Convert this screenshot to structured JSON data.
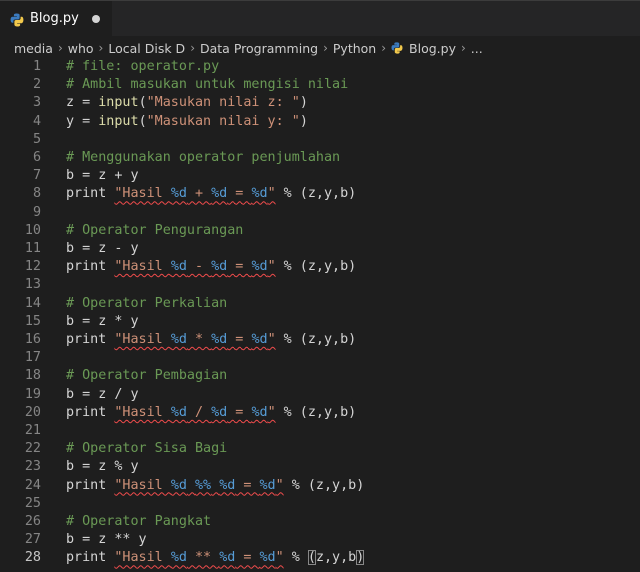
{
  "tab": {
    "label": "Blog.py",
    "icon": "python-file-icon",
    "dirty": true
  },
  "breadcrumb": [
    "media",
    "who",
    "Local Disk D",
    "Data Programming",
    "Python",
    "Blog.py",
    "..."
  ],
  "colors": {
    "background": "#1e1e1e",
    "comment": "#6a9955",
    "string": "#ce9178",
    "format": "#569cd6",
    "function": "#dcdcaa",
    "error_squiggle": "#f14c4c"
  },
  "active_line": 28,
  "lines": [
    {
      "num": "1",
      "tokens": [
        {
          "t": "# file: operator.py",
          "c": "comment"
        }
      ]
    },
    {
      "num": "2",
      "tokens": [
        {
          "t": "# Ambil masukan untuk mengisi nilai",
          "c": "comment"
        }
      ]
    },
    {
      "num": "3",
      "tokens": [
        {
          "t": "z = ",
          "c": "plain"
        },
        {
          "t": "input",
          "c": "func"
        },
        {
          "t": "(",
          "c": "plain"
        },
        {
          "t": "\"Masukan nilai z: \"",
          "c": "string"
        },
        {
          "t": ")",
          "c": "plain"
        }
      ]
    },
    {
      "num": "4",
      "tokens": [
        {
          "t": "y = ",
          "c": "plain"
        },
        {
          "t": "input",
          "c": "func"
        },
        {
          "t": "(",
          "c": "plain"
        },
        {
          "t": "\"Masukan nilai y: \"",
          "c": "string"
        },
        {
          "t": ")",
          "c": "plain"
        }
      ]
    },
    {
      "num": "5",
      "tokens": []
    },
    {
      "num": "6",
      "tokens": [
        {
          "t": "# Menggunakan operator penjumlahan",
          "c": "comment"
        }
      ]
    },
    {
      "num": "7",
      "tokens": [
        {
          "t": "b = z + y",
          "c": "plain"
        }
      ]
    },
    {
      "num": "8",
      "tokens": [
        {
          "t": "print ",
          "c": "plain"
        },
        {
          "t": "\"Hasil ",
          "c": "string",
          "err": true
        },
        {
          "t": "%d",
          "c": "fmt",
          "err": true
        },
        {
          "t": " + ",
          "c": "string",
          "err": true
        },
        {
          "t": "%d",
          "c": "fmt",
          "err": true
        },
        {
          "t": " = ",
          "c": "string",
          "err": true
        },
        {
          "t": "%d",
          "c": "fmt",
          "err": true
        },
        {
          "t": "\"",
          "c": "string",
          "err": true
        },
        {
          "t": " % (z,y,b)",
          "c": "plain"
        }
      ]
    },
    {
      "num": "9",
      "tokens": []
    },
    {
      "num": "10",
      "tokens": [
        {
          "t": "# Operator Pengurangan",
          "c": "comment"
        }
      ]
    },
    {
      "num": "11",
      "tokens": [
        {
          "t": "b = z - y",
          "c": "plain"
        }
      ]
    },
    {
      "num": "12",
      "tokens": [
        {
          "t": "print ",
          "c": "plain"
        },
        {
          "t": "\"Hasil ",
          "c": "string",
          "err": true
        },
        {
          "t": "%d",
          "c": "fmt",
          "err": true
        },
        {
          "t": " - ",
          "c": "string",
          "err": true
        },
        {
          "t": "%d",
          "c": "fmt",
          "err": true
        },
        {
          "t": " = ",
          "c": "string",
          "err": true
        },
        {
          "t": "%d",
          "c": "fmt",
          "err": true
        },
        {
          "t": "\"",
          "c": "string",
          "err": true
        },
        {
          "t": " % (z,y,b)",
          "c": "plain"
        }
      ]
    },
    {
      "num": "13",
      "tokens": []
    },
    {
      "num": "14",
      "tokens": [
        {
          "t": "# Operator Perkalian",
          "c": "comment"
        }
      ]
    },
    {
      "num": "15",
      "tokens": [
        {
          "t": "b = z * y",
          "c": "plain"
        }
      ]
    },
    {
      "num": "16",
      "tokens": [
        {
          "t": "print ",
          "c": "plain"
        },
        {
          "t": "\"Hasil ",
          "c": "string",
          "err": true
        },
        {
          "t": "%d",
          "c": "fmt",
          "err": true
        },
        {
          "t": " * ",
          "c": "string",
          "err": true
        },
        {
          "t": "%d",
          "c": "fmt",
          "err": true
        },
        {
          "t": " = ",
          "c": "string",
          "err": true
        },
        {
          "t": "%d",
          "c": "fmt",
          "err": true
        },
        {
          "t": "\"",
          "c": "string",
          "err": true
        },
        {
          "t": " % (z,y,b)",
          "c": "plain"
        }
      ]
    },
    {
      "num": "17",
      "tokens": []
    },
    {
      "num": "18",
      "tokens": [
        {
          "t": "# Operator Pembagian",
          "c": "comment"
        }
      ]
    },
    {
      "num": "19",
      "tokens": [
        {
          "t": "b = z / y",
          "c": "plain"
        }
      ]
    },
    {
      "num": "20",
      "tokens": [
        {
          "t": "print ",
          "c": "plain"
        },
        {
          "t": "\"Hasil ",
          "c": "string",
          "err": true
        },
        {
          "t": "%d",
          "c": "fmt",
          "err": true
        },
        {
          "t": " / ",
          "c": "string",
          "err": true
        },
        {
          "t": "%d",
          "c": "fmt",
          "err": true
        },
        {
          "t": " = ",
          "c": "string",
          "err": true
        },
        {
          "t": "%d",
          "c": "fmt",
          "err": true
        },
        {
          "t": "\"",
          "c": "string",
          "err": true
        },
        {
          "t": " % (z,y,b)",
          "c": "plain"
        }
      ]
    },
    {
      "num": "21",
      "tokens": []
    },
    {
      "num": "22",
      "tokens": [
        {
          "t": "# Operator Sisa Bagi",
          "c": "comment"
        }
      ]
    },
    {
      "num": "23",
      "tokens": [
        {
          "t": "b = z % y",
          "c": "plain"
        }
      ]
    },
    {
      "num": "24",
      "tokens": [
        {
          "t": "print ",
          "c": "plain"
        },
        {
          "t": "\"Hasil ",
          "c": "string",
          "err": true
        },
        {
          "t": "%d",
          "c": "fmt",
          "err": true
        },
        {
          "t": " ",
          "c": "string",
          "err": true
        },
        {
          "t": "%%",
          "c": "fmt",
          "err": true
        },
        {
          "t": " ",
          "c": "string",
          "err": true
        },
        {
          "t": "%d",
          "c": "fmt",
          "err": true
        },
        {
          "t": " = ",
          "c": "string",
          "err": true
        },
        {
          "t": "%d",
          "c": "fmt",
          "err": true
        },
        {
          "t": "\"",
          "c": "string",
          "err": true
        },
        {
          "t": " % (z,y,b)",
          "c": "plain"
        }
      ]
    },
    {
      "num": "25",
      "tokens": []
    },
    {
      "num": "26",
      "tokens": [
        {
          "t": "# Operator Pangkat",
          "c": "comment"
        }
      ]
    },
    {
      "num": "27",
      "tokens": [
        {
          "t": "b = z ** y",
          "c": "plain"
        }
      ]
    },
    {
      "num": "28",
      "tokens": [
        {
          "t": "print ",
          "c": "plain"
        },
        {
          "t": "\"Hasil ",
          "c": "string",
          "err": true
        },
        {
          "t": "%d",
          "c": "fmt",
          "err": true
        },
        {
          "t": " ** ",
          "c": "string",
          "err": true
        },
        {
          "t": "%d",
          "c": "fmt",
          "err": true
        },
        {
          "t": " = ",
          "c": "string",
          "err": true
        },
        {
          "t": "%d",
          "c": "fmt",
          "err": true
        },
        {
          "t": "\"",
          "c": "string",
          "err": true
        },
        {
          "t": " % ",
          "c": "plain"
        },
        {
          "t": "(",
          "c": "plain",
          "match": true
        },
        {
          "t": "z,y,b",
          "c": "plain"
        },
        {
          "t": ")",
          "c": "plain",
          "match": true
        }
      ]
    }
  ]
}
